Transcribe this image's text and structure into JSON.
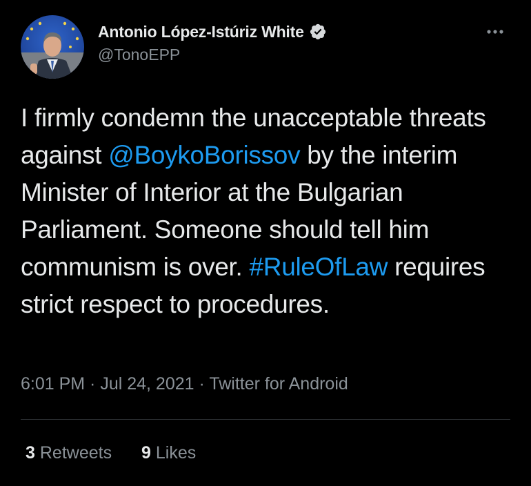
{
  "author": {
    "display_name": "Antonio López-Istúriz White",
    "handle": "@TonoEPP",
    "verified_icon": "verified-badge-icon"
  },
  "tweet": {
    "segments": [
      {
        "text": "I firmly condemn the unacceptable threats against ",
        "type": "text"
      },
      {
        "text": "@BoykoBorissov",
        "type": "mention"
      },
      {
        "text": " by the interim Minister of Interior at the Bulgarian Parliament. Someone should tell him communism is over. ",
        "type": "text"
      },
      {
        "text": "#RuleOfLaw",
        "type": "hashtag"
      },
      {
        "text": " requires strict respect to procedures.",
        "type": "text"
      }
    ],
    "time": "6:01 PM",
    "date": "Jul 24, 2021",
    "source": "Twitter for Android",
    "separator": " · "
  },
  "stats": {
    "retweets_count": "3",
    "retweets_label": "Retweets",
    "likes_count": "9",
    "likes_label": "Likes"
  },
  "colors": {
    "background": "#000000",
    "text": "#e7e9ea",
    "secondary": "#8b9298",
    "link": "#1d9bf0",
    "divider": "#2f3336"
  }
}
